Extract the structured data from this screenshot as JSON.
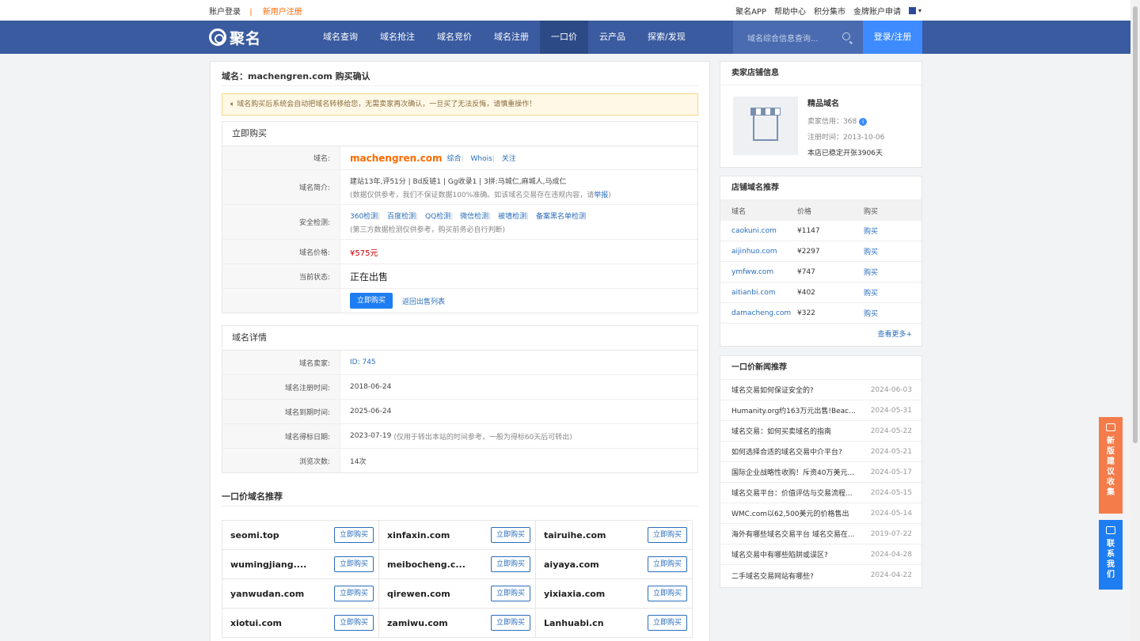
{
  "topbar": {
    "login": "账户登录",
    "register": "新用户注册",
    "links": [
      "聚名APP",
      "帮助中心",
      "积分集市",
      "金牌账户申请"
    ]
  },
  "nav": {
    "brand": "聚名",
    "items": [
      "域名查询",
      "域名抢注",
      "域名竞价",
      "域名注册",
      "一口价",
      "云产品",
      "探索/发现"
    ],
    "active": "一口价",
    "search_placeholder": "域名综合信息查询...",
    "login_register": "登录/注册"
  },
  "page": {
    "title": "域名：machengren.com 购买确认",
    "notice": "域名购买后系统会自动把域名转移给您，无需卖家再次确认，一旦买了无法反悔，请慎重操作！"
  },
  "buy": {
    "head": "立即购买",
    "rows": {
      "domain_label": "域名:",
      "domain": "machengren.com",
      "domain_links": [
        "综合",
        "Whois",
        "关注"
      ],
      "intro_label": "域名简介:",
      "intro": "建站13年,评51分 | Bd反链1 | Gg收录1 | 3拼:马城仁,麻城人,马成仁",
      "intro_note": "(数据仅供参考，我们不保证数据100%准确。如该域名交易存在违规内容，请",
      "report": "举报",
      "intro_end": ")",
      "security_label": "安全检测:",
      "security_links": [
        "360检测",
        "百度检测",
        "QQ检测",
        "微信检测",
        "被墙检测",
        "备案黑名单检测"
      ],
      "security_note": "(第三方数据检测仅供参考，购买前务必自行判断)",
      "price_label": "域名价格:",
      "price": "¥575元",
      "status_label": "当前状态:",
      "status": "正在出售",
      "buy_button": "立即购买",
      "back_link": "返回出售列表"
    }
  },
  "detail": {
    "head": "域名详情",
    "rows": [
      {
        "label": "域名卖家:",
        "value": "ID: 745"
      },
      {
        "label": "域名注册时间:",
        "value": "2018-06-24"
      },
      {
        "label": "域名到期时间:",
        "value": "2025-06-24"
      },
      {
        "label": "域名得标日期:",
        "value": "2023-07-19",
        "note": "(仅用于转出本站的时间参考，一般为得标60天后可转出)"
      },
      {
        "label": "浏览次数:",
        "value": "14次"
      }
    ]
  },
  "recommend": {
    "title": "一口价域名推荐",
    "button": "立即购买",
    "items": [
      "seomi.top",
      "xinfaxin.com",
      "tairuihe.com",
      "wumingjiang....",
      "meibocheng.c...",
      "aiyaya.com",
      "yanwudan.com",
      "qirewen.com",
      "yixiaxia.com",
      "xiotui.com",
      "zamiwu.com",
      "Lanhuabi.cn"
    ]
  },
  "store": {
    "head": "卖家店铺信息",
    "name": "精品域名",
    "credit": "卖家信用：368",
    "reg": "注册时间：2013-10-06",
    "stable": "本店已稳定开张3906天"
  },
  "store_domains": {
    "head": "店铺域名推荐",
    "cols": [
      "域名",
      "价格",
      "购买"
    ],
    "rows": [
      {
        "d": "caokuni.com",
        "p": "¥1147",
        "b": "购买"
      },
      {
        "d": "aijinhuo.com",
        "p": "¥2297",
        "b": "购买"
      },
      {
        "d": "ymfww.com",
        "p": "¥747",
        "b": "购买"
      },
      {
        "d": "aitianbi.com",
        "p": "¥402",
        "b": "购买"
      },
      {
        "d": "damacheng.com",
        "p": "¥322",
        "b": "购买"
      }
    ],
    "more": "查看更多+"
  },
  "news": {
    "head": "一口价新闻推荐",
    "items": [
      {
        "t": "域名交易如何保证安全的?",
        "d": "2024-06-03"
      },
      {
        "t": "Humanity.org约163万元出售!Beac...",
        "d": "2024-05-31"
      },
      {
        "t": "域名交易：如何买卖域名的指南",
        "d": "2024-05-22"
      },
      {
        "t": "如何选择合适的域名交易中介平台?",
        "d": "2024-05-21"
      },
      {
        "t": "国际企业战略性收购！斥资40万美元...",
        "d": "2024-05-17"
      },
      {
        "t": "域名交易平台：价值评估与交易流程...",
        "d": "2024-05-15"
      },
      {
        "t": "WMC.com以62,500美元的价格售出",
        "d": "2024-05-14"
      },
      {
        "t": "海外有哪些域名交易平台 域名交易在...",
        "d": "2019-07-22"
      },
      {
        "t": "域名交易中有哪些陷阱或误区?",
        "d": "2024-04-28"
      },
      {
        "t": "二手域名交易网站有哪些?",
        "d": "2024-04-22"
      }
    ]
  },
  "floating": {
    "feedback": [
      "新",
      "版",
      "建",
      "议",
      "收",
      "集"
    ],
    "contact": [
      "联",
      "系",
      "我",
      "们"
    ]
  },
  "colors": {
    "nav": "#3a5ba0",
    "accent": "#ff6a00",
    "primary": "#1e7df0",
    "feedback": "#f47c4a",
    "contact": "#1e7df0"
  }
}
